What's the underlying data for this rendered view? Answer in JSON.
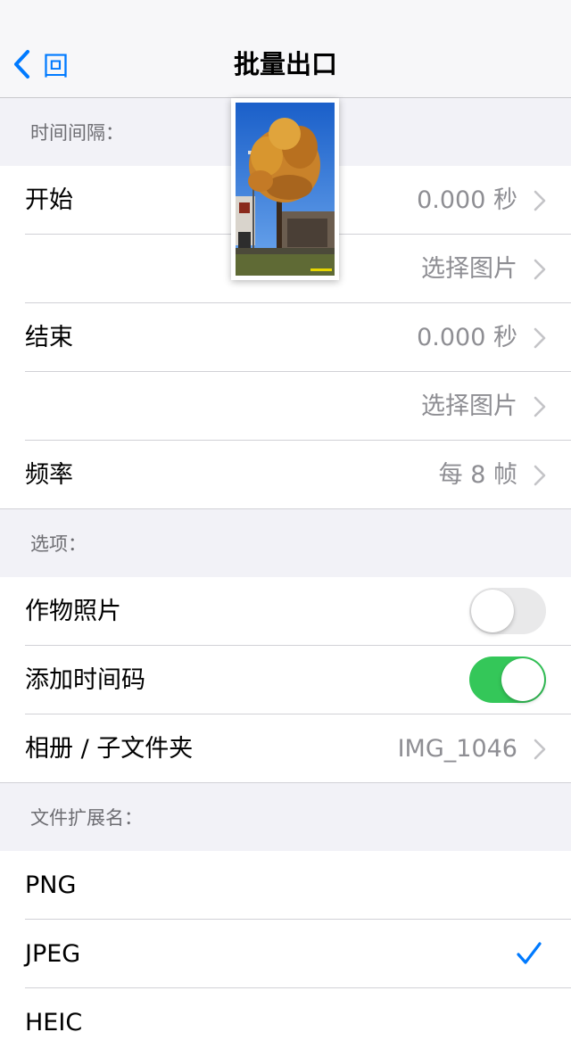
{
  "nav": {
    "back_label": "回",
    "title": "批量出口"
  },
  "sections": {
    "interval_header": "时间间隔：",
    "options_header": "选项：",
    "extension_header": "文件扩展名："
  },
  "interval": {
    "start_label": "开始",
    "start_value": "0.000 秒",
    "start_pick": "选择图片",
    "end_label": "结束",
    "end_value": "0.000 秒",
    "end_pick": "选择图片",
    "frequency_label": "频率",
    "frequency_value": "每 8 帧"
  },
  "options": {
    "crop_label": "作物照片",
    "crop_enabled": false,
    "timecode_label": "添加时间码",
    "timecode_enabled": true,
    "album_label": "相册 / 子文件夹",
    "album_value": "IMG_1046"
  },
  "extensions": {
    "items": [
      "PNG",
      "JPEG",
      "HEIC"
    ],
    "selected": "JPEG"
  },
  "colors": {
    "accent": "#007aff",
    "toggle_on": "#34c759",
    "toggle_off": "#e9e9ea",
    "secondary_text": "#8e8e93",
    "grouped_background": "#f2f2f7"
  },
  "icons": {
    "back": "chevron-left-icon",
    "disclosure": "chevron-right-icon",
    "selected": "checkmark-icon"
  }
}
